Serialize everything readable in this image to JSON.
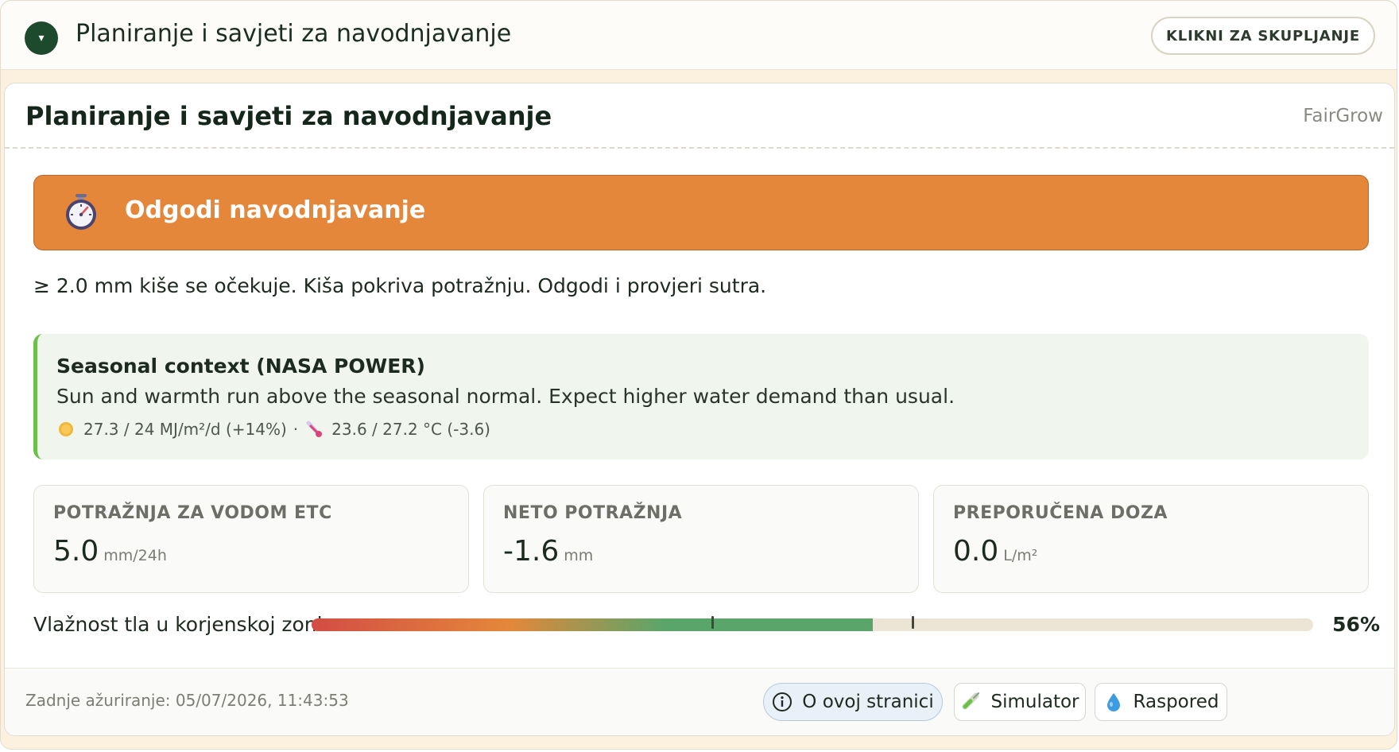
{
  "header": {
    "toggle_glyph": "▾",
    "title": "Planiranje i savjeti za navodnjavanje",
    "collapse_label": "KLIKNI ZA SKUPLJANJE"
  },
  "card": {
    "title": "Planiranje i savjeti za navodnjavanje",
    "brand": "FairGrow"
  },
  "alert": {
    "icon": "stopwatch-icon",
    "title": "Odgodi navodnjavanje",
    "color": "#e4873a"
  },
  "message": "≥ 2.0 mm kiše se očekuje. Kiša pokriva potražnju. Odgodi i provjeri sutra.",
  "seasonal": {
    "title": "Seasonal context (NASA POWER)",
    "text": "Sun and warmth run above the seasonal normal. Expect higher water demand than usual.",
    "solar": "27.3 / 24 MJ/m²/d (+14%)",
    "separator": "·",
    "temperature": "23.6 / 27.2 °C (-3.6)",
    "accent": "#6cc04a"
  },
  "metrics": [
    {
      "label": "POTRAŽNJA ZA VODOM ETC",
      "value": "5.0",
      "unit": "mm/24h"
    },
    {
      "label": "NETO POTRAŽNJA",
      "value": "-1.6",
      "unit": "mm"
    },
    {
      "label": "PREPORUČENA DOZA",
      "value": "0.0",
      "unit": "L/m²"
    }
  ],
  "moisture": {
    "label": "Vlažnost tla u korjenskoj zoni",
    "percent_text": "56%",
    "value": 0.56,
    "markers": [
      0.4,
      0.6
    ]
  },
  "footer": {
    "updated": "Zadnje ažuriranje: 05/07/2026, 11:43:53",
    "about_label": "O ovoj stranici",
    "simulator_label": "Simulator",
    "schedule_label": "Raspored"
  }
}
